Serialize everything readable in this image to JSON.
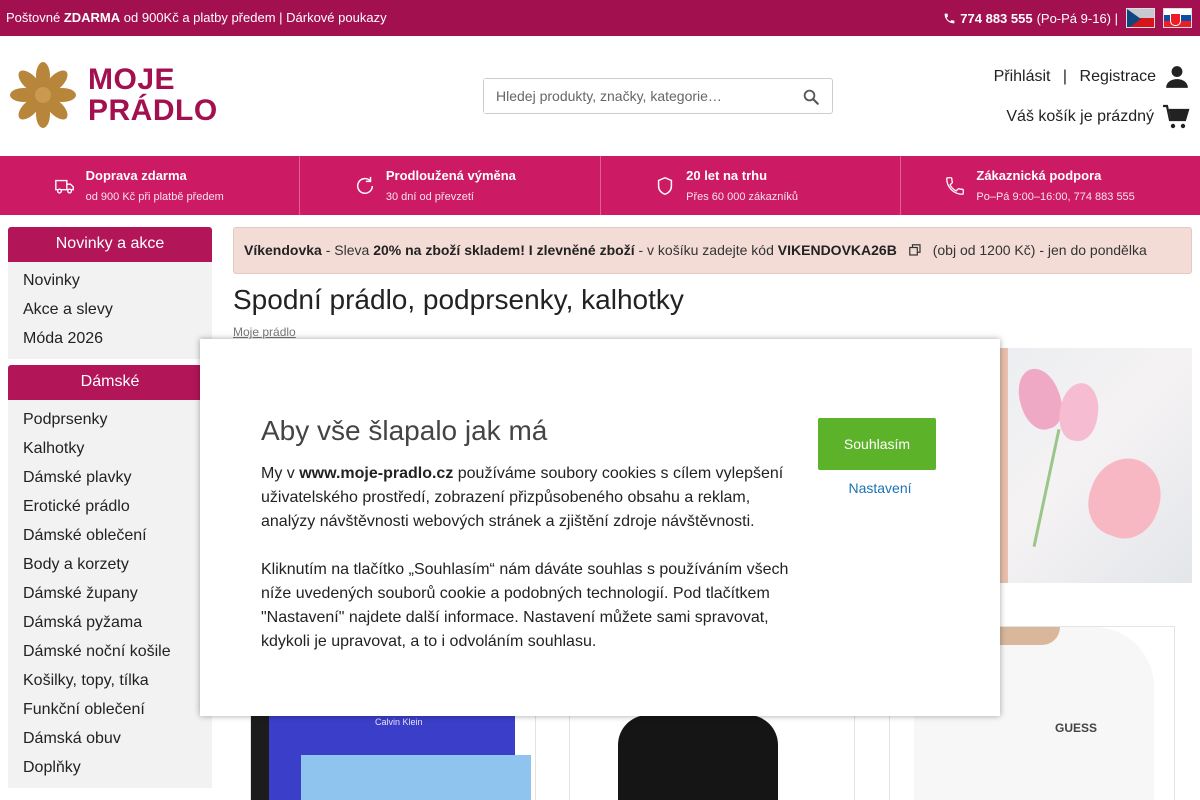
{
  "topbar": {
    "shipping_prefix": "Poštovné ",
    "shipping_bold": "ZDARMA",
    "shipping_suffix": " od 900Kč a platby předem | Dárkové poukazy",
    "phone": "774 883 555",
    "hours": " (Po-Pá 9-16) |",
    "flags": [
      "cz-flag",
      "sk-flag"
    ]
  },
  "header": {
    "logo_line1": "MOJE",
    "logo_line2": "PRÁDLO",
    "search_placeholder": "Hledej produkty, značky, kategorie…",
    "login": "Přihlásit",
    "separator": " | ",
    "register": "Registrace",
    "cart": "Váš košík je prázdný"
  },
  "benefits": [
    {
      "title": "Doprava zdarma",
      "sub": "od 900 Kč při platbě předem",
      "icon": "truck-icon"
    },
    {
      "title": "Prodloužená výměna",
      "sub": "30 dní od převzetí",
      "icon": "refresh-icon"
    },
    {
      "title": "20 let na trhu",
      "sub": "Přes 60 000 zákazníků",
      "icon": "shield-icon"
    },
    {
      "title": "Zákaznická podpora",
      "sub": "Po–Pá 9:00–16:00, 774 883 555",
      "icon": "phone-icon"
    }
  ],
  "sidebar": {
    "sections": [
      {
        "title": "Novinky a akce",
        "items": [
          "Novinky",
          "Akce a slevy",
          "Móda 2026"
        ]
      },
      {
        "title": "Dámské",
        "items": [
          "Podprsenky",
          "Kalhotky",
          "Dámské plavky",
          "Erotické prádlo",
          "Dámské oblečení",
          "Body a korzety",
          "Dámské župany",
          "Dámská pyžama",
          "Dámské noční košile",
          "Košilky, topy, tílka",
          "Funkční oblečení",
          "Dámská obuv",
          "Doplňky"
        ]
      }
    ]
  },
  "promo": {
    "name": "Víkendovka",
    "t1": " - Sleva ",
    "bold1": "20% na zboží skladem! I zlevněné zboží",
    "t2": " - v košíku zadejte kód ",
    "code": "VIKENDOVKA26B",
    "t3": "(obj od 1200 Kč) - jen do pondělka"
  },
  "page": {
    "title": "Spodní prádlo, podprsenky, kalhotky",
    "breadcrumb": "Moje prádlo"
  },
  "products": [
    {
      "brand": "Calvin Klein"
    },
    {
      "brand": ""
    },
    {
      "brand": "GUESS"
    }
  ],
  "cookie_modal": {
    "title": "Aby vše šlapalo jak má",
    "p1_a": "My v ",
    "p1_bold": "www.moje-pradlo.cz",
    "p1_b": " používáme soubory cookies s cílem vylepšení uživatelského prostředí, zobrazení přizpůsobeného obsahu a reklam, analýzy návštěvnosti webových stránek a zjištění zdroje návštěvnosti.",
    "p2": "Kliknutím na tlačítko „Souhlasím“ nám dáváte souhlas s používáním všech níže uvedených souborů cookie a podobných technologií. Pod tlačítkem \"Nastavení\" najdete další informace. Nastavení můžete sami spravovat, kdykoli je upravovat, a to i odvoláním souhlasu.",
    "agree_label": "Souhlasím",
    "settings_label": "Nastavení"
  },
  "colors": {
    "brand": "#a3104f",
    "benefit_bar": "#cc1b64",
    "logo_flower": "#b8863b",
    "agree": "#5cb329",
    "link": "#1a73b5"
  }
}
